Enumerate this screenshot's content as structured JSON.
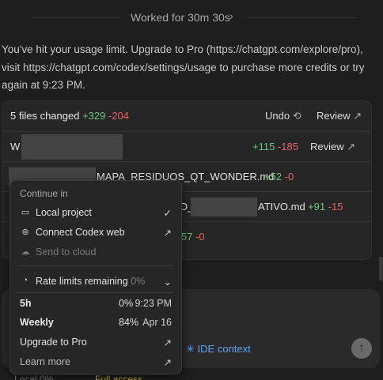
{
  "worked": {
    "text": "Worked for 30m 30s",
    "chevron": "›"
  },
  "message": "You've hit your usage limit. Upgrade to Pro (https://chatgpt.com/explore/pro), visit https://chatgpt.com/codex/settings/usage to purchase more credits or try again at 9:23 PM.",
  "files": {
    "summary": "5 files changed",
    "added": "+329",
    "removed": "-204",
    "undo_label": "Undo",
    "review_label": "Review",
    "rows": [
      {
        "name": "W",
        "added": "+115",
        "removed": "-185",
        "review": "Review"
      },
      {
        "name": "MAPA_RESIDUOS_QT_WONDER.md",
        "added": "+52",
        "removed": "-0"
      },
      {
        "name_prefix": "O_",
        "name": "ATIVO.md",
        "added": "+91",
        "removed": "-15"
      },
      {
        "added": "57",
        "removed": "-0"
      }
    ]
  },
  "menu": {
    "heading": "Continue in",
    "local_project": "Local project",
    "connect_web": "Connect Codex web",
    "send_cloud": "Send to cloud",
    "rate_limits": "Rate limits remaining",
    "rate_pct": "0%",
    "limits": [
      {
        "label": "5h",
        "pct": "0%",
        "time": "9:23 PM"
      },
      {
        "label": "Weekly",
        "pct": "84%",
        "time": "Apr 16"
      }
    ],
    "upgrade": "Upgrade to Pro",
    "learn_more": "Learn more"
  },
  "composer": {
    "ide_context": "IDE context",
    "send_icon": "arrow-up-icon"
  },
  "bottom": {
    "left": "Local 0%",
    "right": "Full access"
  },
  "colors": {
    "added": "#6cc27c",
    "removed": "#e5625e",
    "link": "#5ba3f3"
  }
}
